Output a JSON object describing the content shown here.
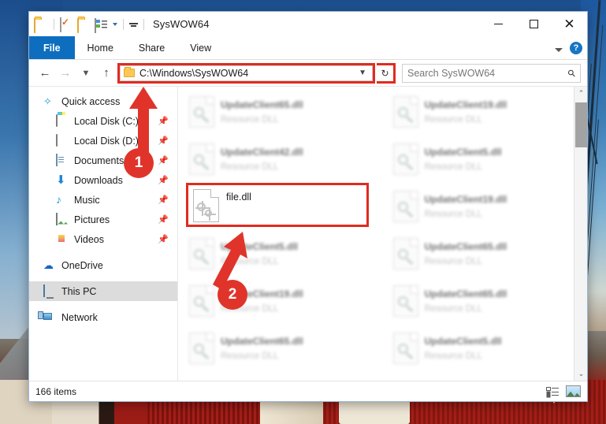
{
  "window": {
    "title": "SysWOW64",
    "quick_access_toolbar": [
      {
        "name": "folder-icon",
        "label": "Folder"
      },
      {
        "name": "properties-icon",
        "label": "Properties"
      },
      {
        "name": "new-folder-icon",
        "label": "New folder"
      },
      {
        "name": "customize-quick-access-icon",
        "label": "Customize Quick Access Toolbar"
      }
    ],
    "controls": {
      "minimize": "–",
      "maximize": "□",
      "close": "✕"
    }
  },
  "ribbon": {
    "tabs": [
      {
        "label": "File",
        "active": true
      },
      {
        "label": "Home",
        "active": false
      },
      {
        "label": "Share",
        "active": false
      },
      {
        "label": "View",
        "active": false
      }
    ],
    "collapse_label": "▼",
    "help_label": "?"
  },
  "addressbar": {
    "back": "←",
    "forward": "→",
    "recent": "⌄",
    "up": "↑",
    "path": "C:\\Windows\\SysWOW64",
    "dropdown": "⌄",
    "refresh": "↻",
    "highlighted": true
  },
  "search": {
    "placeholder": "Search SysWOW64",
    "icon": "⌕"
  },
  "sidebar": {
    "items": [
      {
        "label": "Quick access",
        "icon": "pin-star-icon",
        "indent": false,
        "pinned": false,
        "selected": false
      },
      {
        "label": "Local Disk (C:)",
        "icon": "disk-c-icon",
        "indent": true,
        "pinned": true,
        "selected": false
      },
      {
        "label": "Local Disk (D:)",
        "icon": "disk-d-icon",
        "indent": true,
        "pinned": true,
        "selected": false
      },
      {
        "label": "Documents",
        "icon": "documents-icon",
        "indent": true,
        "pinned": true,
        "selected": false
      },
      {
        "label": "Downloads",
        "icon": "downloads-icon",
        "indent": true,
        "pinned": true,
        "selected": false
      },
      {
        "label": "Music",
        "icon": "music-icon",
        "indent": true,
        "pinned": true,
        "selected": false
      },
      {
        "label": "Pictures",
        "icon": "pictures-icon",
        "indent": true,
        "pinned": true,
        "selected": false
      },
      {
        "label": "Videos",
        "icon": "videos-icon",
        "indent": true,
        "pinned": true,
        "selected": false
      },
      {
        "label": "OneDrive",
        "icon": "onedrive-icon",
        "indent": false,
        "pinned": false,
        "selected": false
      },
      {
        "label": "This PC",
        "icon": "this-pc-icon",
        "indent": false,
        "pinned": false,
        "selected": true
      },
      {
        "label": "Network",
        "icon": "network-icon",
        "indent": false,
        "pinned": false,
        "selected": false
      }
    ],
    "pin_glyph": "📌"
  },
  "files": {
    "selected": {
      "name": "file.dll",
      "icon": "dll-gear-icon"
    },
    "items": [
      {
        "name": "UpdateClient65.dll",
        "type": "Resource DLL"
      },
      {
        "name": "UpdateClient19.dll",
        "type": "Resource DLL"
      },
      {
        "name": "UpdateClient42.dll",
        "type": "Resource DLL"
      },
      {
        "name": "UpdateClient5.dll",
        "type": "Resource DLL"
      },
      {
        "name": "UpdateClient19.dll",
        "type": "Resource DLL"
      },
      {
        "name": "UpdateClient5.dll",
        "type": "Resource DLL"
      },
      {
        "name": "UpdateClient65.dll",
        "type": "Resource DLL"
      },
      {
        "name": "UpdateClient19.dll",
        "type": "Resource DLL"
      },
      {
        "name": "UpdateClient65.dll",
        "type": "Resource DLL"
      },
      {
        "name": "UpdateClient65.dll",
        "type": "Resource DLL"
      },
      {
        "name": "UpdateClient5.dll",
        "type": "Resource DLL"
      }
    ]
  },
  "scrollbar": {
    "up": "⌃",
    "down": "⌄"
  },
  "status": {
    "item_count": "166 items",
    "details_view": "Details view",
    "large_icons_view": "Large icons view"
  },
  "annotations": [
    {
      "number": "1",
      "target": "address-bar"
    },
    {
      "number": "2",
      "target": "file-dll-item"
    }
  ],
  "colors": {
    "accent": "#0d6ebf",
    "annotation_red": "#e02b1f",
    "selection": "#dcdcdc"
  }
}
